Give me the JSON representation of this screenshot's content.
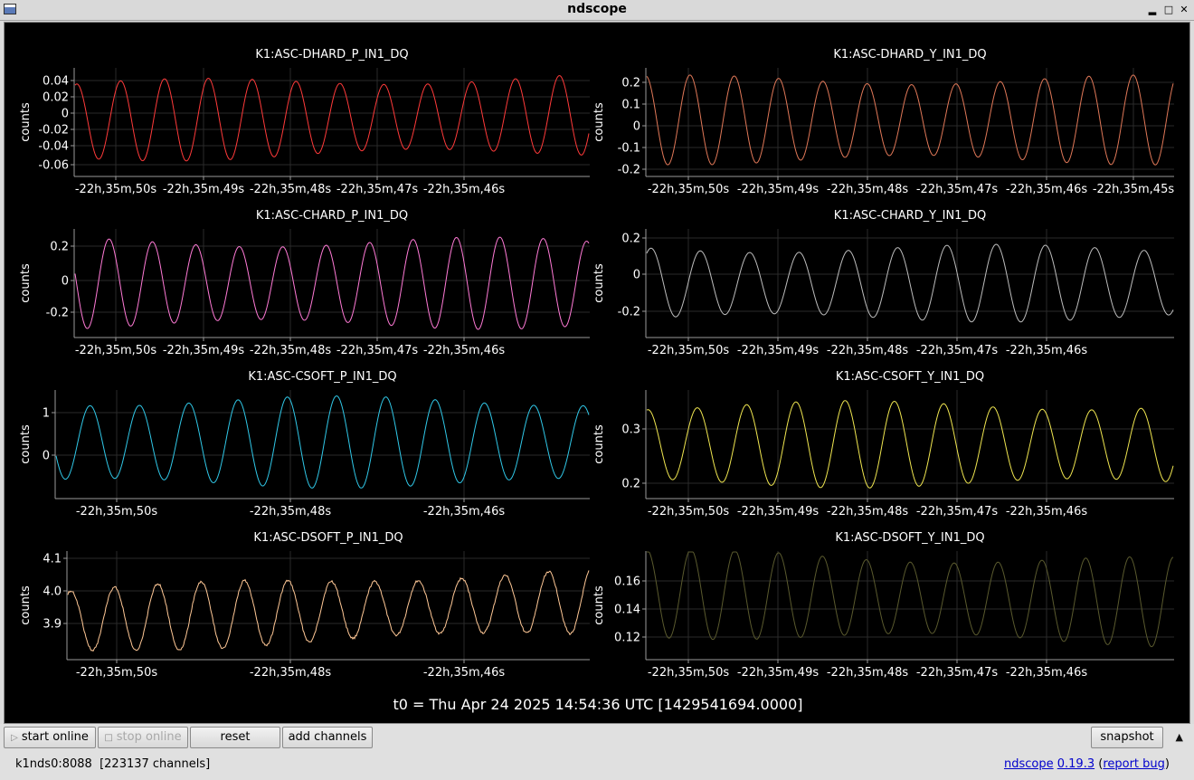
{
  "window": {
    "title": "ndscope"
  },
  "plots": [
    {
      "title": "K1:ASC-DHARD_P_IN1_DQ",
      "ylabel": "counts",
      "color": "#ff3a3a",
      "yticks": [
        "0.04",
        "0.02",
        "0",
        "-0.02",
        "-0.04",
        "-0.06"
      ],
      "xticks": [
        "-22h,35m,50s",
        "-22h,35m,49s",
        "-22h,35m,48s",
        "-22h,35m,47s",
        "-22h,35m,46s"
      ]
    },
    {
      "title": "K1:ASC-DHARD_Y_IN1_DQ",
      "ylabel": "counts",
      "color": "#e07858",
      "yticks": [
        "0.2",
        "0.1",
        "0",
        "-0.1",
        "-0.2"
      ],
      "xticks": [
        "-22h,35m,50s",
        "-22h,35m,49s",
        "-22h,35m,48s",
        "-22h,35m,47s",
        "-22h,35m,46s",
        "-22h,35m,45s"
      ]
    },
    {
      "title": "K1:ASC-CHARD_P_IN1_DQ",
      "ylabel": "counts",
      "color": "#ff7ad6",
      "yticks": [
        "0.2",
        "0",
        "-0.2"
      ],
      "xticks": [
        "-22h,35m,50s",
        "-22h,35m,49s",
        "-22h,35m,48s",
        "-22h,35m,47s",
        "-22h,35m,46s"
      ]
    },
    {
      "title": "K1:ASC-CHARD_Y_IN1_DQ",
      "ylabel": "counts",
      "color": "#bdbdbd",
      "yticks": [
        "0.2",
        "0",
        "-0.2"
      ],
      "xticks": [
        "-22h,35m,50s",
        "-22h,35m,49s",
        "-22h,35m,48s",
        "-22h,35m,47s",
        "-22h,35m,46s"
      ]
    },
    {
      "title": "K1:ASC-CSOFT_P_IN1_DQ",
      "ylabel": "counts",
      "color": "#30c8e8",
      "yticks": [
        "1",
        "0"
      ],
      "xticks": [
        "-22h,35m,50s",
        "-22h,35m,48s",
        "-22h,35m,46s"
      ]
    },
    {
      "title": "K1:ASC-CSOFT_Y_IN1_DQ",
      "ylabel": "counts",
      "color": "#f0e650",
      "yticks": [
        "0.3",
        "0.2"
      ],
      "xticks": [
        "-22h,35m,50s",
        "-22h,35m,49s",
        "-22h,35m,48s",
        "-22h,35m,47s",
        "-22h,35m,46s"
      ]
    },
    {
      "title": "K1:ASC-DSOFT_P_IN1_DQ",
      "ylabel": "counts",
      "color": "#ffc896",
      "yticks": [
        "4.1",
        "4.0",
        "3.9"
      ],
      "xticks": [
        "-22h,35m,50s",
        "-22h,35m,48s",
        "-22h,35m,46s"
      ]
    },
    {
      "title": "K1:ASC-DSOFT_Y_IN1_DQ",
      "ylabel": "counts",
      "color": "#5a5a2e",
      "yticks": [
        "0.16",
        "0.14",
        "0.12"
      ],
      "xticks": [
        "-22h,35m,50s",
        "-22h,35m,49s",
        "-22h,35m,48s",
        "-22h,35m,47s",
        "-22h,35m,46s"
      ]
    }
  ],
  "t0_label": "t0 = Thu Apr 24 2025 14:54:36 UTC [1429541694.0000]",
  "toolbar": {
    "start_online": "start online",
    "stop_online": "stop online",
    "reset": "reset",
    "add_channels": "add channels",
    "snapshot": "snapshot"
  },
  "status": {
    "server": "k1nds0:8088",
    "channels": "[223137 channels]"
  },
  "about": {
    "app": "ndscope",
    "version": "0.19.3",
    "report": "report bug"
  }
}
